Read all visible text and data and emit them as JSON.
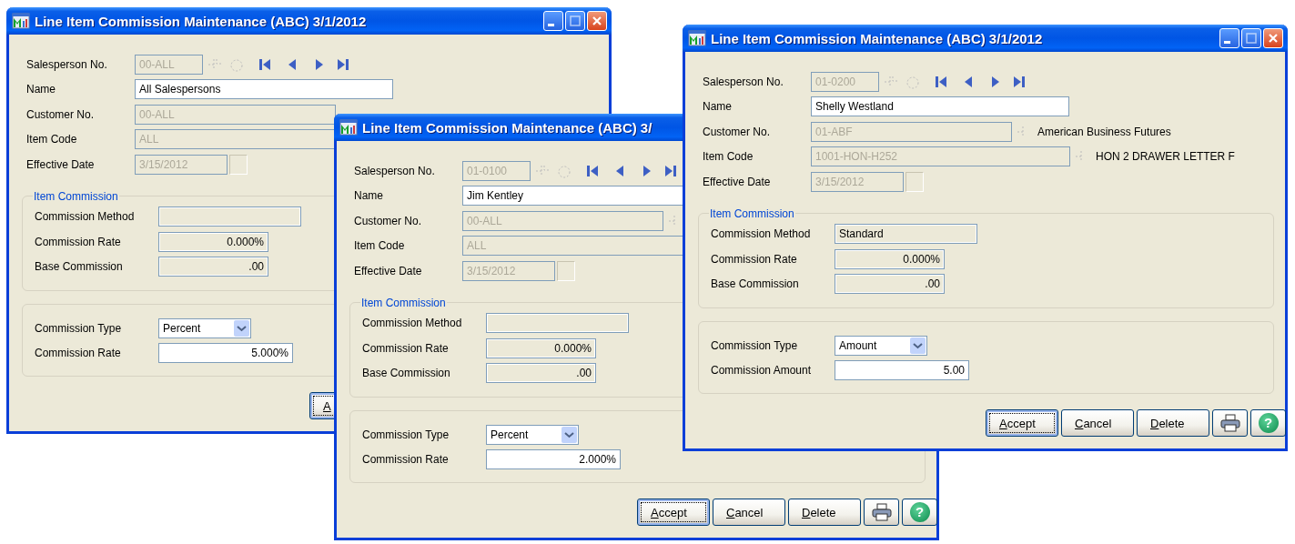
{
  "windows": [
    {
      "title": "Line Item Commission Maintenance (ABC) 3/1/2012",
      "header_fields": [
        {
          "label": "Salesperson No.",
          "kind": "key",
          "disabled": true,
          "editable": false,
          "value": "00-ALL"
        },
        {
          "label": "Name",
          "kind": "text",
          "disabled": false,
          "editable": true,
          "value": "All Salespersons"
        },
        {
          "label": "Customer No.",
          "kind": "lookup",
          "disabled": true,
          "editable": false,
          "value": "00-ALL"
        },
        {
          "label": "Item Code",
          "kind": "lookup",
          "disabled": true,
          "editable": false,
          "value": "ALL"
        },
        {
          "label": "Effective Date",
          "kind": "date",
          "disabled": true,
          "editable": false,
          "value": "3/15/2012"
        }
      ],
      "item_commission": {
        "title": "Item Commission",
        "fields": [
          {
            "label": "Commission Method",
            "kind": "text",
            "disabled": false,
            "editable": false
          },
          {
            "label": "Commission Rate",
            "kind": "number",
            "disabled": false,
            "editable": false,
            "value": "0.000%"
          },
          {
            "label": "Base Commission",
            "kind": "number",
            "disabled": false,
            "editable": false,
            "value": ".00"
          }
        ]
      },
      "commission": {
        "fields": [
          {
            "label": "Commission Type",
            "kind": "select",
            "disabled": false,
            "editable": true,
            "value": "Percent"
          },
          {
            "label": "Commission Rate",
            "kind": "number",
            "disabled": false,
            "editable": true,
            "value": "5.000%"
          }
        ]
      },
      "buttons": [
        {
          "kind": "text",
          "label": "A",
          "default": true
        }
      ]
    },
    {
      "title": "Line Item Commission Maintenance (ABC) 3/",
      "header_fields": [
        {
          "label": "Salesperson No.",
          "kind": "key",
          "disabled": true,
          "editable": false,
          "value": "01-0100"
        },
        {
          "label": "Name",
          "kind": "text",
          "disabled": false,
          "editable": true,
          "value": "Jim Kentley"
        },
        {
          "label": "Customer No.",
          "kind": "lookup",
          "disabled": true,
          "editable": false,
          "value": "00-ALL"
        },
        {
          "label": "Item Code",
          "kind": "lookup",
          "disabled": true,
          "editable": false,
          "value": "ALL"
        },
        {
          "label": "Effective Date",
          "kind": "date",
          "disabled": true,
          "editable": false,
          "value": "3/15/2012"
        }
      ],
      "item_commission": {
        "title": "Item Commission",
        "fields": [
          {
            "label": "Commission Method",
            "kind": "text",
            "disabled": false,
            "editable": false
          },
          {
            "label": "Commission Rate",
            "kind": "number",
            "disabled": false,
            "editable": false,
            "value": "0.000%"
          },
          {
            "label": "Base Commission",
            "kind": "number",
            "disabled": false,
            "editable": false,
            "value": ".00"
          }
        ]
      },
      "commission": {
        "fields": [
          {
            "label": "Commission Type",
            "kind": "select",
            "disabled": false,
            "editable": true,
            "value": "Percent"
          },
          {
            "label": "Commission Rate",
            "kind": "number",
            "disabled": false,
            "editable": true,
            "value": "2.000%"
          }
        ]
      },
      "buttons": [
        {
          "kind": "text",
          "label": "Accept",
          "default": true
        },
        {
          "kind": "text",
          "label": "Cancel",
          "default": false
        },
        {
          "kind": "text",
          "label": "Delete",
          "default": false
        },
        {
          "kind": "print"
        },
        {
          "kind": "help",
          "label": "?"
        }
      ]
    },
    {
      "title": "Line Item Commission Maintenance (ABC) 3/1/2012",
      "header_fields": [
        {
          "label": "Salesperson No.",
          "kind": "key",
          "disabled": true,
          "editable": false,
          "value": "01-0200"
        },
        {
          "label": "Name",
          "kind": "text",
          "disabled": false,
          "editable": true,
          "value": "Shelly Westland"
        },
        {
          "label": "Customer No.",
          "kind": "lookup",
          "disabled": true,
          "editable": false,
          "value": "01-ABF",
          "description": "American Business Futures"
        },
        {
          "label": "Item Code",
          "kind": "lookup",
          "disabled": true,
          "editable": false,
          "value": "1001-HON-H252",
          "description": "HON 2 DRAWER LETTER F"
        },
        {
          "label": "Effective Date",
          "kind": "date",
          "disabled": true,
          "editable": false,
          "value": "3/15/2012"
        }
      ],
      "item_commission": {
        "title": "Item Commission",
        "fields": [
          {
            "label": "Commission Method",
            "kind": "text",
            "disabled": false,
            "editable": false,
            "value": "Standard"
          },
          {
            "label": "Commission Rate",
            "kind": "number",
            "disabled": false,
            "editable": false,
            "value": "0.000%"
          },
          {
            "label": "Base Commission",
            "kind": "number",
            "disabled": false,
            "editable": false,
            "value": ".00"
          }
        ]
      },
      "commission": {
        "fields": [
          {
            "label": "Commission Type",
            "kind": "select",
            "disabled": false,
            "editable": true,
            "value": "Amount"
          },
          {
            "label": "Commission Amount",
            "kind": "number",
            "disabled": false,
            "editable": true,
            "value": "5.00"
          }
        ]
      },
      "buttons": [
        {
          "kind": "text",
          "label": "Accept",
          "default": true
        },
        {
          "kind": "text",
          "label": "Cancel",
          "default": false
        },
        {
          "kind": "text",
          "label": "Delete",
          "default": false
        },
        {
          "kind": "print"
        },
        {
          "kind": "help",
          "label": "?"
        }
      ]
    }
  ]
}
